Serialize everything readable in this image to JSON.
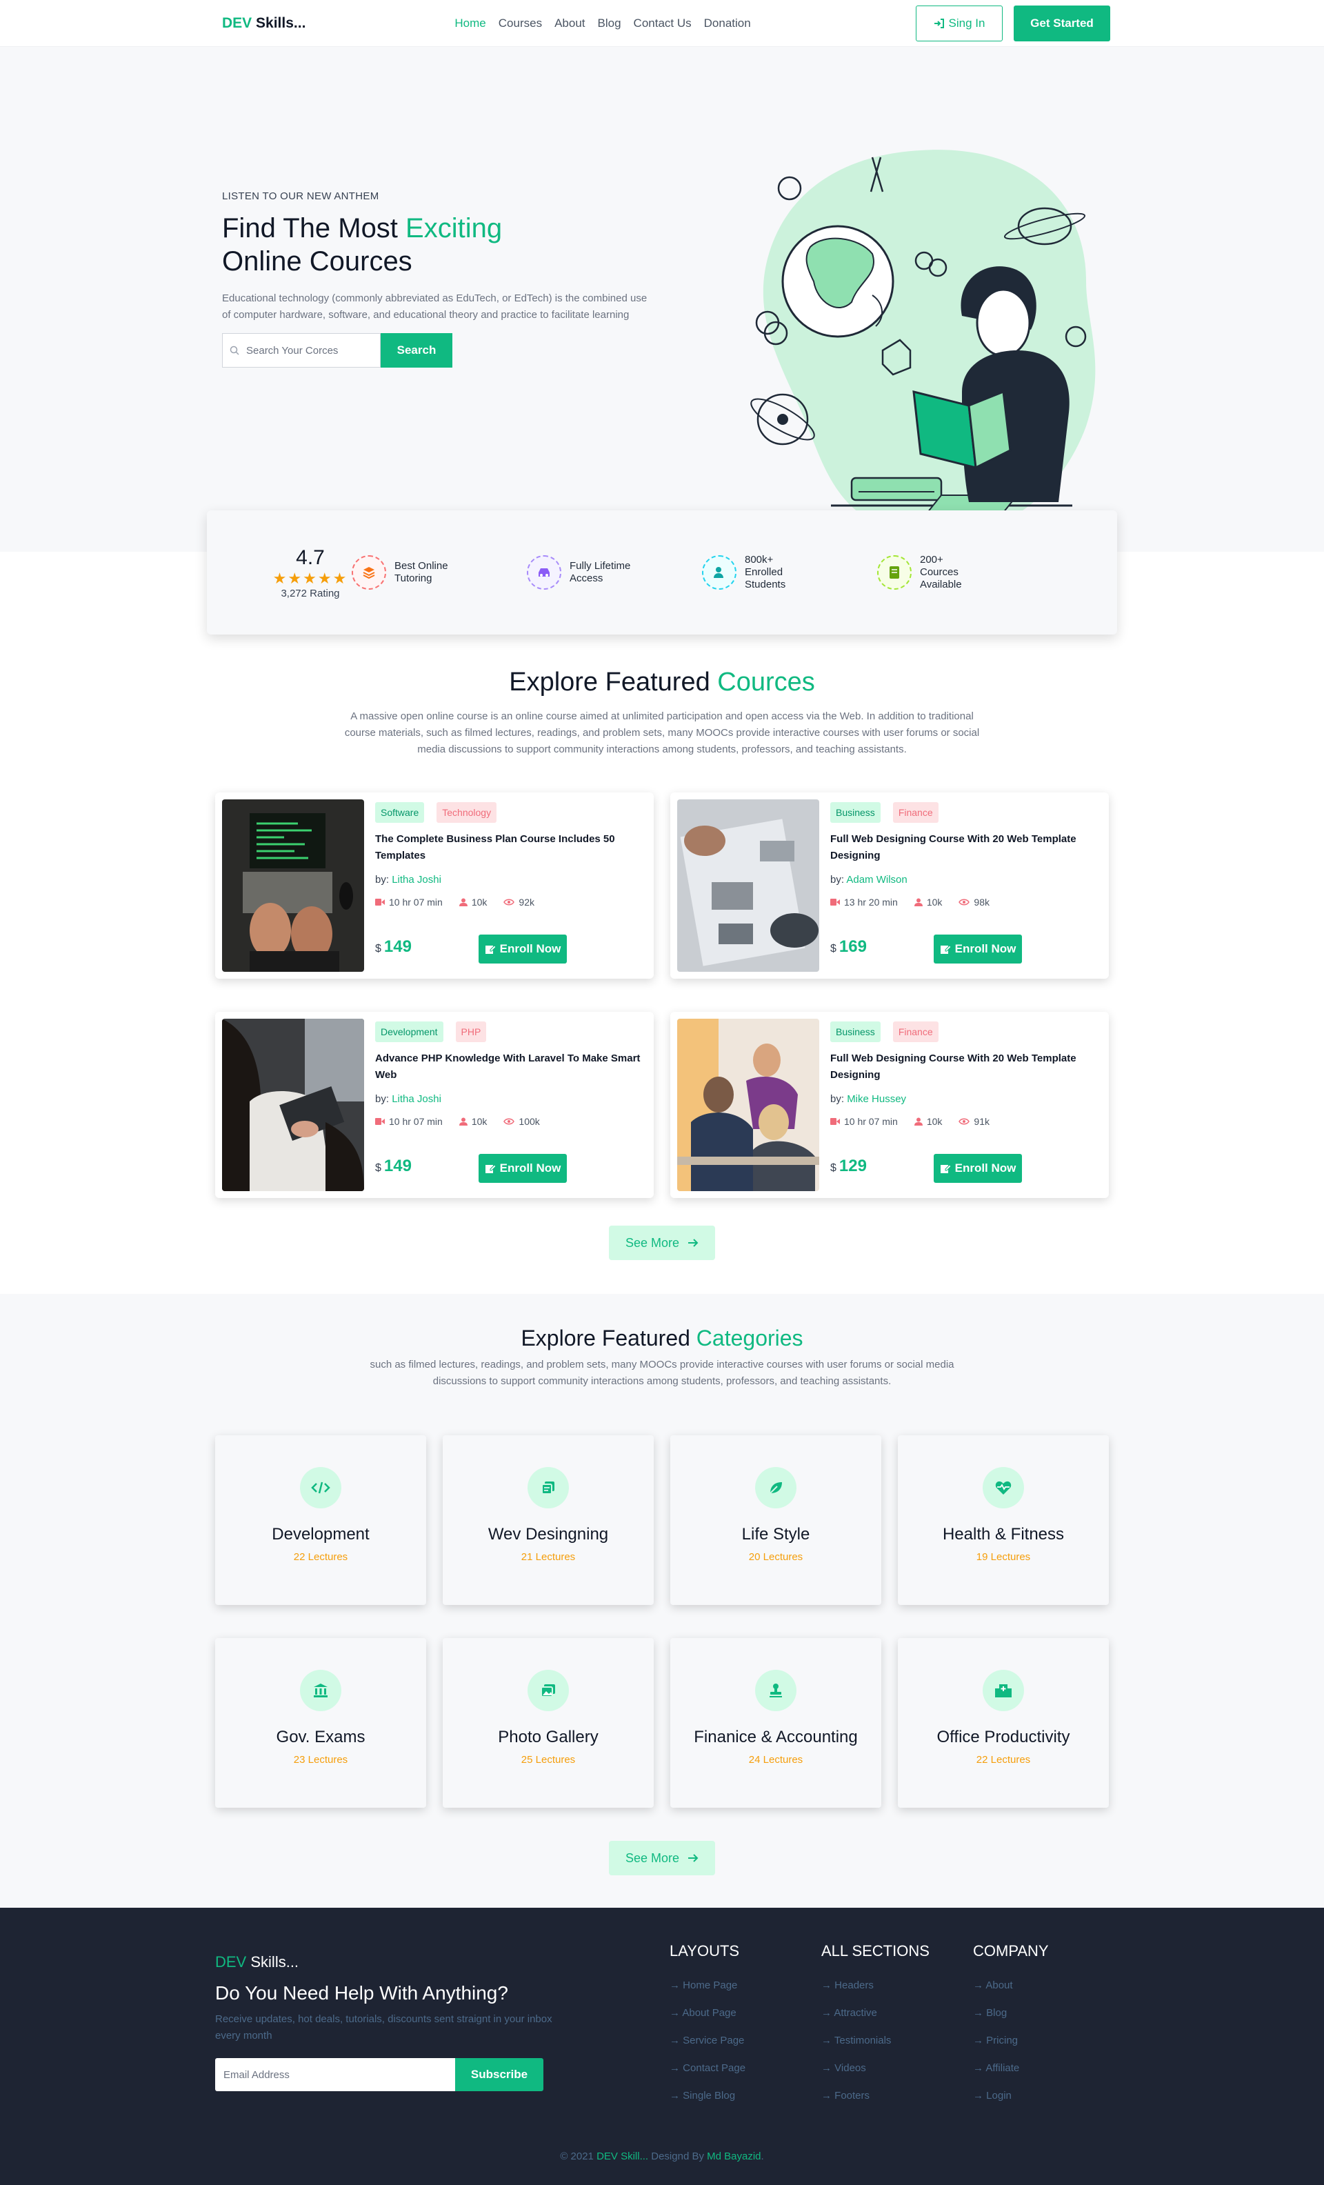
{
  "nav": {
    "logo_a": "DEV",
    "logo_b": "Skills...",
    "links": [
      "Home",
      "Courses",
      "About",
      "Blog",
      "Contact Us",
      "Donation"
    ],
    "signin": "Sing In",
    "get_started": "Get Started"
  },
  "hero": {
    "kicker": "LISTEN TO OUR NEW ANTHEM",
    "title_a": "Find The Most ",
    "title_green": "Exciting",
    "title_b": "Online Cources",
    "desc": "Educational technology (commonly abbreviated as EduTech, or EdTech) is the combined use of computer hardware, software, and educational theory and practice to facilitate learning",
    "search_placeholder": "Search Your Corces",
    "search_button": "Search"
  },
  "stats": {
    "rating": "4.7",
    "rating_label": "3,272 Rating",
    "stars": 5,
    "items": [
      {
        "label": "Best Online Tutoring",
        "color": "#f87171",
        "icon": "layers-icon"
      },
      {
        "label": "Fully Lifetime Access",
        "color": "#a78bfa",
        "icon": "car-icon"
      },
      {
        "label": "800k+ Enrolled Students",
        "color": "#22d3ee",
        "icon": "user-icon"
      },
      {
        "label": "200+ Cources Available",
        "color": "#84cc16",
        "icon": "book-icon"
      }
    ]
  },
  "courses": {
    "title_a": "Explore Featured ",
    "title_green": "Cources",
    "desc": "A massive open online course is an online course aimed at unlimited participation and open access via the Web. In addition to traditional course materials, such as filmed lectures, readings, and problem sets, many MOOCs provide interactive courses with user forums or social media discussions to support community interactions among students, professors, and teaching assistants.",
    "by_label": "by:",
    "currency": "$",
    "enroll": "Enroll Now",
    "see_more": "See More",
    "items": [
      {
        "tag1": "Software",
        "tag2": "Technology",
        "title": "The Complete Business Plan Course Includes 50 Templates",
        "author": "Litha Joshi",
        "duration": "10 hr 07 min",
        "students": "10k",
        "views": "92k",
        "price": "149"
      },
      {
        "tag1": "Business",
        "tag2": "Finance",
        "title": "Full Web Designing Course With 20 Web Template Designing",
        "author": "Adam Wilson",
        "duration": "13 hr 20 min",
        "students": "10k",
        "views": "98k",
        "price": "169"
      },
      {
        "tag1": "Development",
        "tag2": "PHP",
        "title": "Advance PHP Knowledge With Laravel To Make Smart Web",
        "author": "Litha Joshi",
        "duration": "10 hr 07 min",
        "students": "10k",
        "views": "100k",
        "price": "149"
      },
      {
        "tag1": "Business",
        "tag2": "Finance",
        "title": "Full Web Designing Course With 20 Web Template Designing",
        "author": "Mike Hussey",
        "duration": "10 hr 07 min",
        "students": "10k",
        "views": "91k",
        "price": "129"
      }
    ]
  },
  "categories": {
    "title_a": "Explore Featured ",
    "title_green": "Categories",
    "desc": "such as filmed lectures, readings, and problem sets, many MOOCs provide interactive courses with user forums or social media discussions to support community interactions among students, professors, and teaching assistants.",
    "see_more": "See More",
    "items": [
      {
        "name": "Development",
        "lectures": "22 Lectures",
        "icon": "code-icon"
      },
      {
        "name": "Wev Desingning",
        "lectures": "21 Lectures",
        "icon": "copy-icon"
      },
      {
        "name": "Life Style",
        "lectures": "20 Lectures",
        "icon": "leaf-icon"
      },
      {
        "name": "Health & Fitness",
        "lectures": "19 Lectures",
        "icon": "heartbeat-icon"
      },
      {
        "name": "Gov. Exams",
        "lectures": "23 Lectures",
        "icon": "bank-icon"
      },
      {
        "name": "Photo Gallery",
        "lectures": "25 Lectures",
        "icon": "images-icon"
      },
      {
        "name": "Finanice & Accounting",
        "lectures": "24 Lectures",
        "icon": "stamp-icon"
      },
      {
        "name": "Office Productivity",
        "lectures": "22 Lectures",
        "icon": "hospital-icon"
      }
    ]
  },
  "footer": {
    "logo_a": "DEV",
    "logo_b": "Skills...",
    "help": "Do You Need Help With Anything?",
    "desc": "Receive updates, hot deals, tutorials, discounts sent straignt in your inbox every month",
    "email_placeholder": "Email Address",
    "subscribe": "Subscribe",
    "columns": [
      {
        "title": "LAYOUTS",
        "links": [
          "Home Page",
          "About Page",
          "Service Page",
          "Contact Page",
          "Single Blog"
        ]
      },
      {
        "title": "ALL SECTIONS",
        "links": [
          "Headers",
          "Attractive",
          "Testimonials",
          "Videos",
          "Footers"
        ]
      },
      {
        "title": "COMPANY",
        "links": [
          "About",
          "Blog",
          "Pricing",
          "Affiliate",
          "Login"
        ]
      }
    ],
    "copy_a": "© 2021 ",
    "copy_brand": "DEV Skill...",
    "copy_b": " Designd By ",
    "copy_author": "Md Bayazid",
    "copy_end": "."
  }
}
